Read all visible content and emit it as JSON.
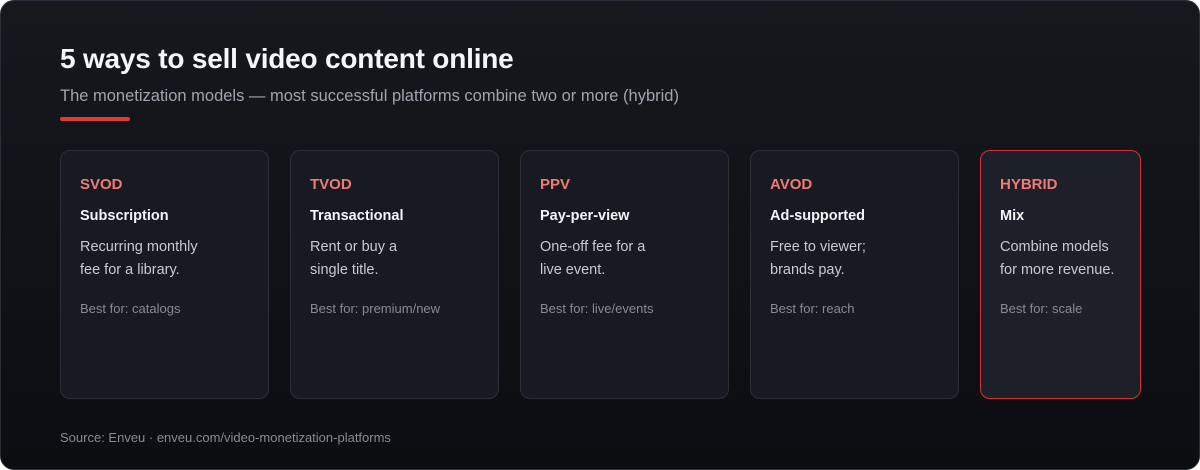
{
  "header": {
    "title": "5 ways to sell video content online",
    "subtitle": "The monetization models — most successful platforms combine two or more (hybrid)"
  },
  "colors": {
    "accent": "#e2393a",
    "code_text": "#f27a74",
    "background": "#0f1014"
  },
  "cards": [
    {
      "code": "SVOD",
      "name": "Subscription",
      "desc_line1": "Recurring monthly",
      "desc_line2": "fee for a library.",
      "best": "Best for: catalogs"
    },
    {
      "code": "TVOD",
      "name": "Transactional",
      "desc_line1": "Rent or buy a",
      "desc_line2": "single title.",
      "best": "Best for: premium/new"
    },
    {
      "code": "PPV",
      "name": "Pay-per-view",
      "desc_line1": "One-off fee for a",
      "desc_line2": "live event.",
      "best": "Best for: live/events"
    },
    {
      "code": "AVOD",
      "name": "Ad-supported",
      "desc_line1": "Free to viewer;",
      "desc_line2": "brands pay.",
      "best": "Best for: reach"
    },
    {
      "code": "HYBRID",
      "name": "Mix",
      "desc_line1": "Combine models",
      "desc_line2": "for more revenue.",
      "best": "Best for: scale",
      "highlighted": true
    }
  ],
  "footer": {
    "source": "Source: Enveu · enveu.com/video-monetization-platforms"
  }
}
